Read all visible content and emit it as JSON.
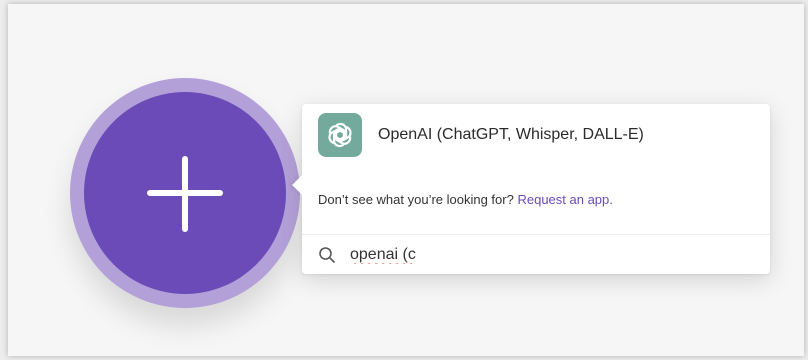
{
  "canvas": {
    "add_module_color": "#6a4bb8",
    "add_module_ring_color": "#b3a0d8"
  },
  "popover": {
    "result": {
      "app_name": "OpenAI (ChatGPT, Whisper, DALL-E)",
      "logo_icon": "openai-logo-icon",
      "logo_color": "#74aa9c"
    },
    "hint": {
      "text": "Don’t see what you’re looking for?",
      "link_label": "Request an app."
    },
    "search": {
      "icon": "search-icon",
      "value": "openai (c"
    }
  }
}
